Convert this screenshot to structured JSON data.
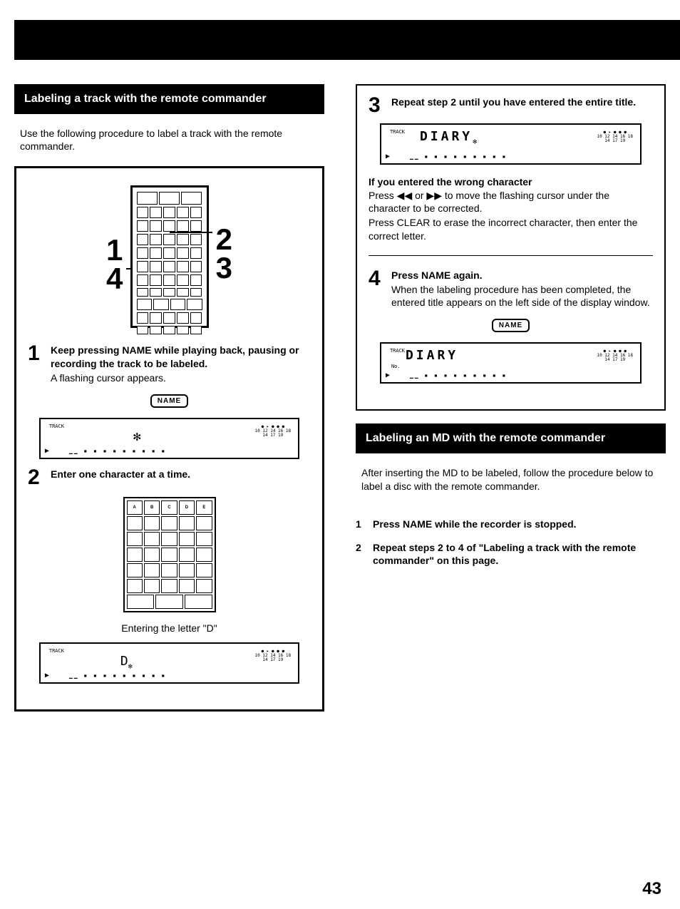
{
  "left": {
    "section_title": "Labeling a track with the remote commander",
    "intro": "Use the following procedure to label a track with the remote commander.",
    "callout_left": "1\n4",
    "callout_right": "2\n3",
    "step1": {
      "num": "1",
      "title": "Keep pressing NAME while playing back, pausing or recording the track to be labeled.",
      "text": "A flashing cursor appears.",
      "name_btn": "NAME",
      "lcd": {
        "track": "TRACK",
        "title_row": "",
        "flash_glyph": "✻",
        "meter": "● ▸ ● ● ●\n10 12 14 16 18\n14 17 19",
        "play": "▶",
        "dashes": "▁▁ ▪ ▪ ▪ ▪ ▪ ▪ ▪ ▪ ▪"
      }
    },
    "step2": {
      "num": "2",
      "title": "Enter one character at a time.",
      "keypad_top_labels": [
        "A",
        "B",
        "C",
        "D",
        "E"
      ],
      "caption": "Entering the letter \"D\"",
      "lcd": {
        "track": "TRACK",
        "title_row": "D",
        "flash_glyph": "✻",
        "meter": "● ▸ ● ● ●\n10 12 14 16 18\n14 17 19",
        "play": "▶",
        "dashes": "▁▁ ▪ ▪ ▪ ▪ ▪ ▪ ▪ ▪ ▪"
      }
    }
  },
  "right": {
    "step3": {
      "num": "3",
      "title": "Repeat step 2 until you have entered the entire title.",
      "lcd": {
        "track": "TRACK",
        "title_row": "DIARY",
        "flash_glyph": "✻",
        "meter": "● ▸ ● ● ●\n10 12 14 16 18\n14 17 19",
        "play": "▶",
        "dashes": "▁▁ ▪ ▪ ▪ ▪ ▪ ▪ ▪ ▪ ▪"
      }
    },
    "wrong_char": {
      "heading": "If you entered the wrong character",
      "line1": "Press ◀◀ or ▶▶ to move the flashing cursor under the character to be corrected.",
      "line2": "Press CLEAR to erase the incorrect character, then enter the correct letter."
    },
    "step4": {
      "num": "4",
      "title": "Press NAME again.",
      "text": "When the labeling procedure has been completed, the entered title appears on the left side of the display window.",
      "name_btn": "NAME",
      "lcd": {
        "track": "TRACK",
        "title_row": "DIARY",
        "no_label": "No.",
        "flash_glyph": "",
        "meter": "● ▸ ● ● ●\n10 12 14 16 18\n14 17 19",
        "play": "▶",
        "dashes": "▁▁ ▪ ▪ ▪ ▪ ▪ ▪ ▪ ▪ ▪"
      }
    },
    "section2": {
      "title": "Labeling an MD with the remote commander",
      "intro": "After inserting the MD to be labeled, follow the procedure below to label a disc with the remote commander.",
      "items": [
        {
          "num": "1",
          "text": "Press NAME while the recorder is stopped."
        },
        {
          "num": "2",
          "text": "Repeat steps 2 to 4 of \"Labeling a track with the remote commander\" on this page."
        }
      ]
    }
  },
  "page_number": "43"
}
